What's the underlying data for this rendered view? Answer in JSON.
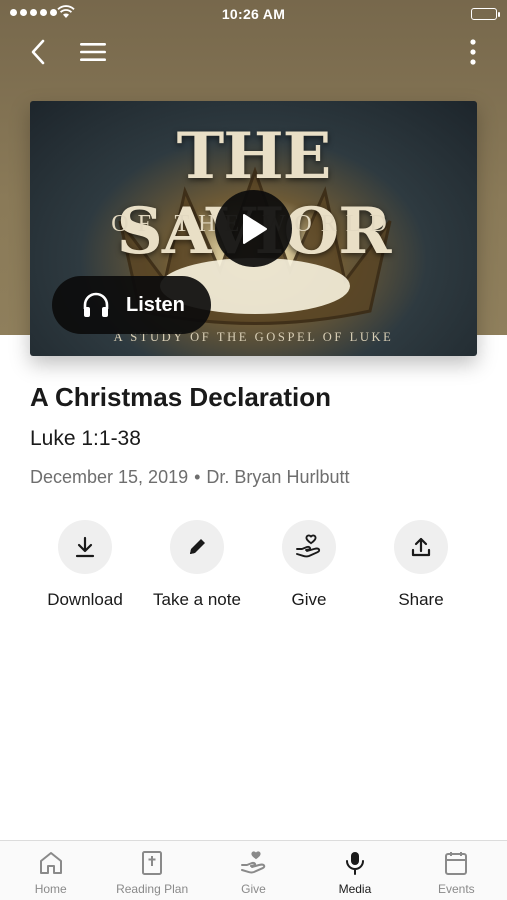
{
  "status_bar": {
    "time": "10:26 AM"
  },
  "artwork": {
    "title_line1": "THE SAVIOR",
    "title_line2": "OF THE WORLD",
    "subtitle": "A STUDY OF THE GOSPEL OF LUKE"
  },
  "player": {
    "listen_label": "Listen"
  },
  "sermon": {
    "title": "A Christmas Declaration",
    "scripture": "Luke 1:1-38",
    "date": "December 15, 2019",
    "separator": "•",
    "speaker": "Dr. Bryan Hurlbutt"
  },
  "actions": [
    {
      "label": "Download",
      "icon": "download-icon"
    },
    {
      "label": "Take a note",
      "icon": "pencil-icon"
    },
    {
      "label": "Give",
      "icon": "give-heart-icon"
    },
    {
      "label": "Share",
      "icon": "share-icon"
    }
  ],
  "tabs": [
    {
      "label": "Home",
      "icon": "home-icon"
    },
    {
      "label": "Reading Plan",
      "icon": "bible-icon"
    },
    {
      "label": "Give",
      "icon": "give-heart-icon"
    },
    {
      "label": "Media",
      "icon": "microphone-icon",
      "active": true
    },
    {
      "label": "Events",
      "icon": "calendar-icon"
    }
  ],
  "colors": {
    "header_bg": "#8a7a58",
    "button_dark": "#0c0c0c",
    "action_bg": "#efefef",
    "inactive_tab": "#8a8a8a"
  }
}
